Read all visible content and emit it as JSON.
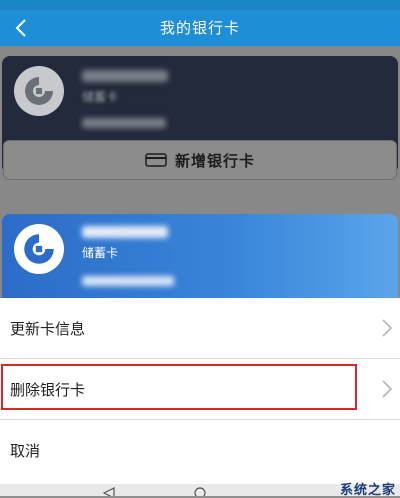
{
  "header": {
    "title": "我的银行卡",
    "back_icon": "chevron-left-icon"
  },
  "cards": [
    {
      "type_label": "储蓄卡"
    },
    {
      "type_label": "储蓄卡"
    }
  ],
  "add_card": {
    "label": "新增银行卡",
    "icon": "card-icon"
  },
  "sheet": {
    "items": [
      {
        "label": "更新卡信息"
      },
      {
        "label": "删除银行卡"
      },
      {
        "label": "取消"
      }
    ]
  },
  "watermark": {
    "text": "系统之家"
  },
  "colors": {
    "header": "#1e8fd6",
    "highlight": "#d9262c",
    "card_active": "#2b6cc8"
  }
}
